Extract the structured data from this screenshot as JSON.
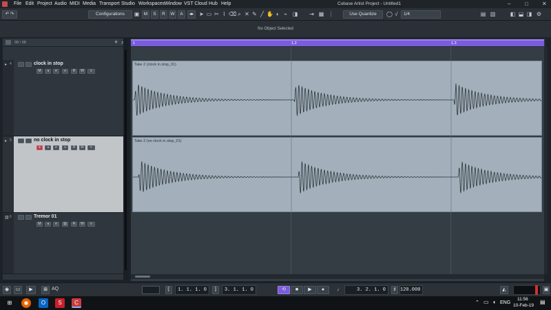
{
  "menu": [
    "File",
    "Edit",
    "Project",
    "Audio",
    "MIDI",
    "Media",
    "Transport",
    "Studio",
    "Workspaces",
    "Window",
    "VST Cloud",
    "Hub",
    "Help"
  ],
  "window_title": "Cubase Artist Project - Untitled1",
  "window_controls": {
    "minimize": "–",
    "maximize": "□",
    "close": "✕"
  },
  "toolbar": {
    "configurations_label": "Configurations",
    "msrwa": [
      "M",
      "S",
      "R",
      "W",
      "A"
    ],
    "quantize_label": "Use Quantize",
    "quantize_value": "1/4"
  },
  "info_line": {
    "text": "No Object Selected"
  },
  "tracklist_header": {
    "counter": "98 / 98",
    "add": "+"
  },
  "tracks": [
    {
      "number": "4",
      "name": "clock in stop",
      "selected": false,
      "event_title": "Take 2 (clock in stop_01)"
    },
    {
      "number": "5",
      "name": "no clock in stop",
      "selected": true,
      "event_title": "Take 2 (no clock in stop_01)"
    },
    {
      "number": "6",
      "name": "Tremor 01",
      "selected": false,
      "event_title": ""
    }
  ],
  "track_buttons": {
    "mute": "M",
    "solo": "S",
    "read": "R",
    "write": "W",
    "e": "e"
  },
  "ruler": {
    "markers": [
      "1",
      "1.2",
      "1.3"
    ]
  },
  "transport": {
    "left_locator": "1. 1. 1.   0",
    "right_locator": "3. 1. 1.   0",
    "position": "3. 2. 1.   0",
    "tempo": "120.000",
    "aq_label": "AQ"
  },
  "taskbar": {
    "language": "ENG",
    "time": "11:56",
    "date": "10-Feb-19",
    "apps": [
      "windows-icon",
      "firefox-icon",
      "outlook-icon",
      "app-s-icon",
      "cubase-icon"
    ]
  },
  "colors": {
    "ruler_accent": "#7b5cdc",
    "event_fill": "#a3b0bb",
    "record_red": "#b7404a"
  }
}
